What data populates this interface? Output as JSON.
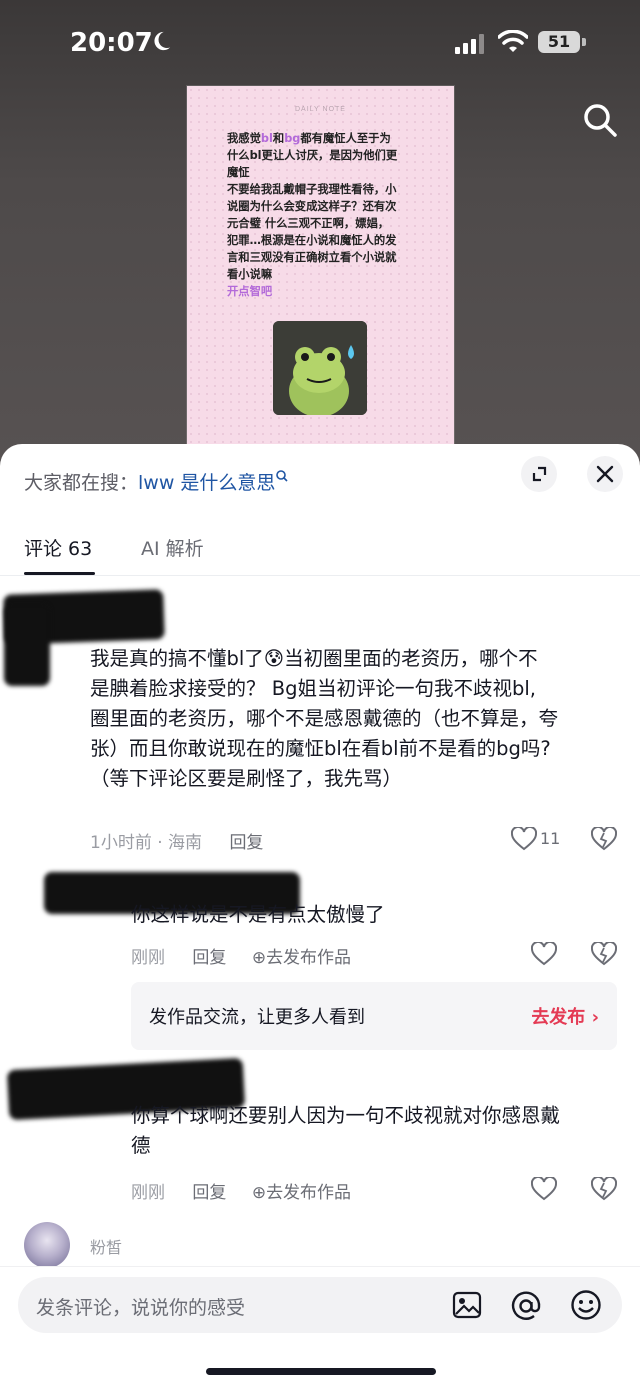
{
  "status": {
    "time": "20:07",
    "battery": "51"
  },
  "note": {
    "header": "DAILY NOTE",
    "line1_a": "我感觉",
    "line1_bl": "bl",
    "line1_b": "和",
    "line1_bg": "bg",
    "line1_c": "都有魔怔人至于为",
    "line2": "什么bl更让人讨厌，是因为他们更",
    "line3": "魔怔",
    "line4": "不要给我乱戴帽子我理性看待，小",
    "line5": "说圈为什么会变成这样子？还有次",
    "line6": "元合璧 什么三观不正啊，嫖娼，",
    "line7": "犯罪…根源是在小说和魔怔人的发",
    "line8": "言和三观没有正确树立看个小说就",
    "line9": "看小说嘛",
    "line10": "开点智吧"
  },
  "sheet": {
    "search_prefix": "大家都在搜：",
    "search_query": "lww 是什么意思",
    "tabs": [
      {
        "label": "评论 63"
      },
      {
        "label": "AI 解析"
      }
    ]
  },
  "comments": [
    {
      "lines": [
        "我是真的搞不懂bl了😰当初圈里面的老资历，哪个不",
        "是腆着脸求接受的？ Bg姐当初评论一句我不歧视bl,",
        "圈里面的老资历，哪个不是感恩戴德的（也不算是，夸",
        "张）而且你敢说现在的魔怔bl在看bl前不是看的bg吗?",
        "（等下评论区要是刷怪了，我先骂）"
      ],
      "time_location": "1小时前 · 海南",
      "reply": "回复",
      "likes": "11"
    },
    {
      "lines": [
        "你这样说是不是有点太傲慢了"
      ],
      "time": "刚刚",
      "reply": "回复",
      "publish": "去发布作品"
    },
    {
      "lines": [
        "你算个球啊还要别人因为一句不歧视就对你感恩戴",
        "德"
      ],
      "time": "刚刚",
      "reply": "回复",
      "publish": "去发布作品"
    }
  ],
  "promo": {
    "text": "发作品交流，让更多人看到",
    "link": "去发布 ›"
  },
  "next_comment": {
    "name": "粉皙"
  },
  "input": {
    "placeholder": "发条评论，说说你的感受"
  }
}
